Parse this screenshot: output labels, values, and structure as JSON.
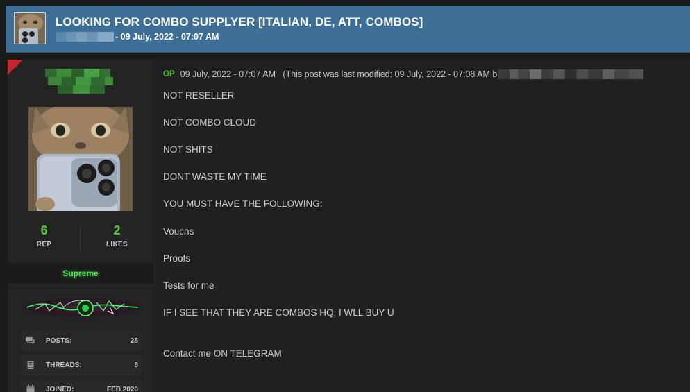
{
  "thread": {
    "title": "LOOKING FOR COMBO SUPPLYER [ITALIAN, DE, ATT, COMBOS]",
    "meta_date": "- 09 July, 2022 - 07:07 AM"
  },
  "user": {
    "stats": [
      {
        "value": "6",
        "label": "REP"
      },
      {
        "value": "2",
        "label": "LIKES"
      }
    ],
    "rank": "Supreme",
    "info": [
      {
        "icon": "chat-bubbles-icon",
        "label": "POSTS:",
        "value": "28"
      },
      {
        "icon": "book-icon",
        "label": "THREADS:",
        "value": "8"
      },
      {
        "icon": "calendar-icon",
        "label": "JOINED:",
        "value": "FEB 2020"
      }
    ],
    "accent": "#5cc83c"
  },
  "post": {
    "op_badge": "OP",
    "meta_text": "09 July, 2022 - 07:07 AM   (This post was last modified: 09 July, 2022 - 07:08 AM b",
    "lines": [
      "NOT RESELLER",
      "NOT COMBO CLOUD",
      "NOT SHITS",
      "DONT WASTE MY TIME",
      "YOU MUST HAVE THE FOLLOWING:",
      "Vouchs",
      "Proofs",
      "Tests for me",
      "IF I SEE THAT THEY ARE COMBOS HQ, I WLL BUY U",
      "Contact me ON TELEGRAM"
    ]
  },
  "colors": {
    "header_bg": "#3c6e96",
    "op_green": "#4bbf34",
    "rank_green": "#52e85c",
    "corner_red": "#c4262e"
  }
}
